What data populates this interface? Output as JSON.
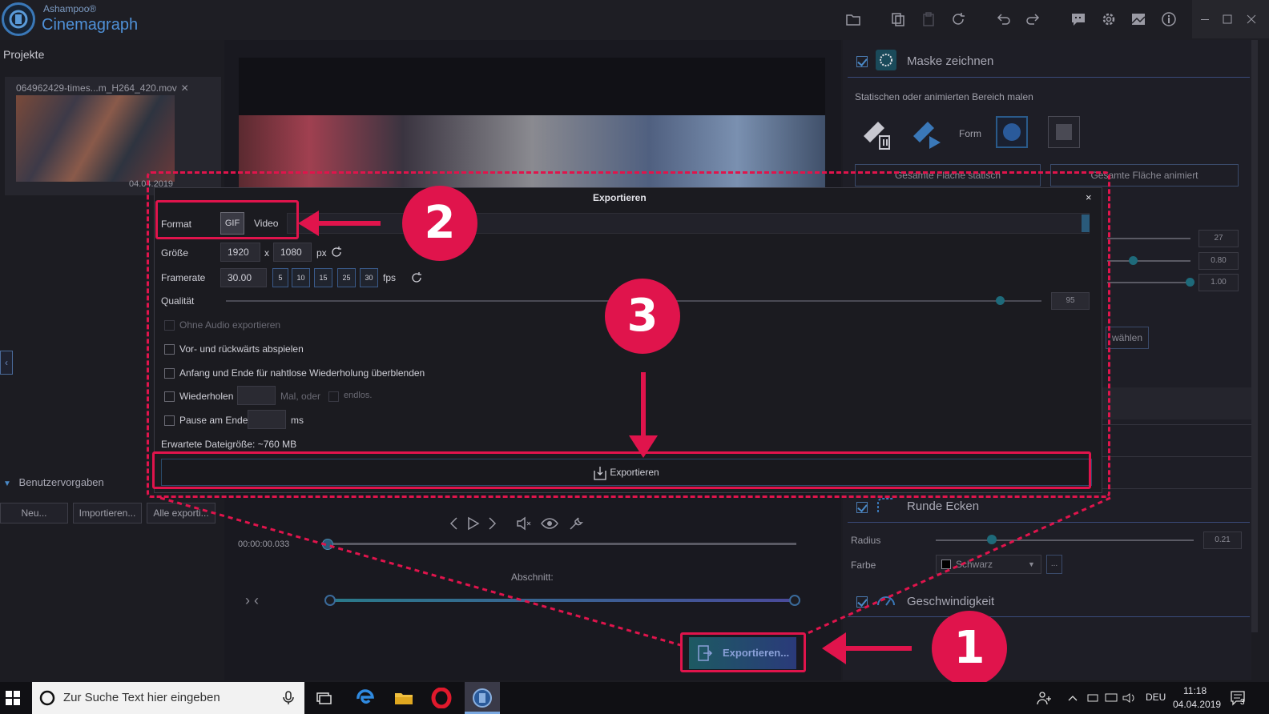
{
  "app": {
    "brand_small": "Ashampoo®",
    "brand_name": "Cinemagraph"
  },
  "toolbar": {
    "icons": [
      "folder-icon",
      "copy-icon",
      "paste-icon",
      "reset-icon",
      "undo-icon",
      "redo-icon",
      "feedback-icon",
      "gear-icon",
      "image-icon",
      "info-icon"
    ],
    "window": [
      "minimize-icon",
      "maximize-icon",
      "close-icon"
    ]
  },
  "left_panel": {
    "title": "Projekte",
    "project": {
      "name": "064962429-times...m_H264_420.mov",
      "close": "×",
      "date": "04.04.2019"
    },
    "collapse": "‹",
    "presets_header": "Benutzervorgaben",
    "presets_buttons": [
      "Neu...",
      "Importieren...",
      "Alle exporti..."
    ]
  },
  "center": {
    "time": "00:00:00.033",
    "abschnitt": "Abschnitt:",
    "nav_arrows": "› ‹",
    "export_button": "Exportieren..."
  },
  "right_panel": {
    "mask_title": "Maske zeichnen",
    "mask_subtitle": "Statischen oder animierten Bereich malen",
    "form_label": "Form",
    "btn_static": "Gesamte Fläche statisch",
    "btn_animated": "Gesamte Fläche animiert",
    "values": [
      "27",
      "0.80",
      "1.00"
    ],
    "waehlen": "wählen",
    "runde_title": "Runde Ecken",
    "radius_label": "Radius",
    "radius_value": "0.21",
    "farbe_label": "Farbe",
    "farbe_value": "Schwarz",
    "farbe_more": "...",
    "gesch_title": "Geschwindigkeit"
  },
  "dialog": {
    "title": "Exportieren",
    "close": "×",
    "format_label": "Format",
    "format_gif": "GIF",
    "format_video": "Video",
    "groesse_label": "Größe",
    "width": "1920",
    "x": "x",
    "height": "1080",
    "px": "px",
    "framerate_label": "Framerate",
    "framerate_value": "30.00",
    "fps_presets": [
      "5",
      "10",
      "15",
      "25",
      "30"
    ],
    "fps": "fps",
    "qualitaet_label": "Qualität",
    "quality_value": "95",
    "quality_level": 0.95,
    "no_audio": "Ohne Audio exportieren",
    "forward_backward": "Vor- und rückwärts abspielen",
    "crossfade": "Anfang und Ende für nahtlose Wiederholung überblenden",
    "repeat_label": "Wiederholen",
    "repeat_times": "Mal, oder",
    "endless": "endlos.",
    "pause_label": "Pause am Ende",
    "ms": "ms",
    "filesize": "Erwartete Dateigröße:  ~760 MB",
    "export_button": "Exportieren"
  },
  "annotations": {
    "badge1": "1",
    "badge2": "2",
    "badge3": "3",
    "accent": "#e0144c"
  },
  "taskbar": {
    "search_placeholder": "Zur Suche Text hier eingeben",
    "language": "DEU",
    "time": "11:18",
    "date": "04.04.2019",
    "notification_count": "3"
  }
}
